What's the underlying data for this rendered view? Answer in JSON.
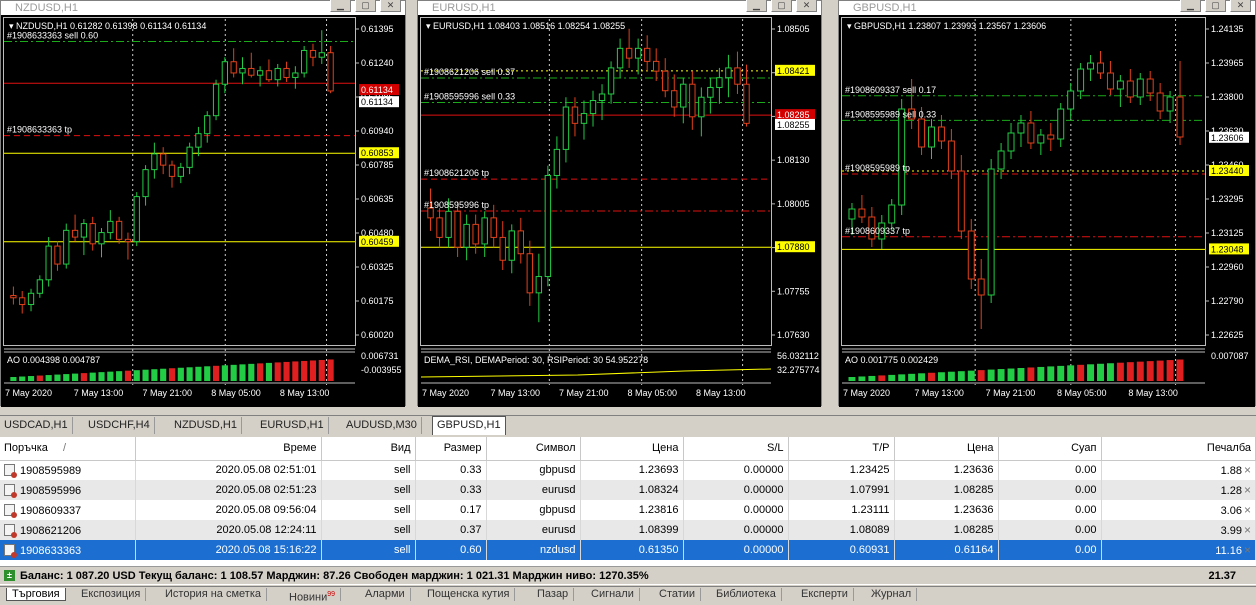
{
  "charts": [
    {
      "window_title": "NZDUSD,H1",
      "ohlc": "NZDUSD,H1  0.61282 0.61398 0.61134 0.61134",
      "price_labels": [
        "0.61395",
        "0.61240",
        "0.61085",
        "0.60940",
        "0.60785",
        "0.60635",
        "0.60480",
        "0.60325",
        "0.60175",
        "0.60020"
      ],
      "highlight_prices": [
        {
          "text": "0.61134",
          "y": 0.61134,
          "bg": "#d40000",
          "fg": "#ffffff"
        },
        {
          "text": "0.61134",
          "y": 0.6108,
          "bg": "#ffffff",
          "fg": "#000000"
        },
        {
          "text": "0.60853",
          "y": 0.60853,
          "bg": "#ffff00",
          "fg": "#000000"
        },
        {
          "text": "0.60459",
          "y": 0.60459,
          "bg": "#ffff00",
          "fg": "#000000"
        }
      ],
      "order_labels": [
        {
          "text": "#1908633363 sell 0.60",
          "y": 0.6135
        },
        {
          "text": "#1908633363 tp",
          "y": 0.60931
        }
      ],
      "hlines": [
        {
          "y": 0.6135,
          "color": "#1aaa1a",
          "style": "dashdot"
        },
        {
          "y": 0.61164,
          "color": "#e01010",
          "style": "solid"
        },
        {
          "y": 0.60931,
          "color": "#e01010",
          "style": "dash"
        },
        {
          "y": 0.60853,
          "color": "#ffff00",
          "style": "solid"
        },
        {
          "y": 0.60459,
          "color": "#ffff00",
          "style": "solid"
        }
      ],
      "indicator": {
        "text": "AO 0.004398 0.004787",
        "scale": [
          "0.006731",
          "-0.003955"
        ],
        "trend": "up"
      },
      "time_labels": [
        "7 May 2020",
        "7 May 13:00",
        "7 May 21:00",
        "8 May 05:00",
        "8 May 13:00"
      ],
      "range": [
        0.6,
        0.6145
      ],
      "candles": [
        [
          0.6022,
          0.6026,
          0.6018,
          0.6021
        ],
        [
          0.6021,
          0.6024,
          0.6014,
          0.6018
        ],
        [
          0.6018,
          0.6025,
          0.6015,
          0.6023
        ],
        [
          0.6023,
          0.6031,
          0.6021,
          0.6029
        ],
        [
          0.6029,
          0.6048,
          0.6026,
          0.6044
        ],
        [
          0.6044,
          0.6046,
          0.6033,
          0.6036
        ],
        [
          0.6036,
          0.6054,
          0.6034,
          0.6051
        ],
        [
          0.6051,
          0.6058,
          0.6046,
          0.6048
        ],
        [
          0.6048,
          0.6056,
          0.604,
          0.6054
        ],
        [
          0.6054,
          0.6057,
          0.6042,
          0.6045
        ],
        [
          0.6045,
          0.6052,
          0.6039,
          0.605
        ],
        [
          0.605,
          0.606,
          0.6047,
          0.6055
        ],
        [
          0.6055,
          0.6057,
          0.6045,
          0.6047
        ],
        [
          0.6047,
          0.605,
          0.6038,
          0.6046
        ],
        [
          0.6046,
          0.6068,
          0.6044,
          0.6066
        ],
        [
          0.6066,
          0.608,
          0.6062,
          0.6078
        ],
        [
          0.6078,
          0.609,
          0.6074,
          0.6085
        ],
        [
          0.6085,
          0.6088,
          0.6076,
          0.608
        ],
        [
          0.608,
          0.6082,
          0.607,
          0.6075
        ],
        [
          0.6075,
          0.6081,
          0.6072,
          0.6079
        ],
        [
          0.6079,
          0.609,
          0.6076,
          0.6088
        ],
        [
          0.6088,
          0.6097,
          0.6084,
          0.6094
        ],
        [
          0.6094,
          0.6104,
          0.609,
          0.6102
        ],
        [
          0.6102,
          0.6118,
          0.61,
          0.6116
        ],
        [
          0.6116,
          0.6128,
          0.6112,
          0.6126
        ],
        [
          0.6126,
          0.6132,
          0.6119,
          0.6121
        ],
        [
          0.6121,
          0.6128,
          0.6116,
          0.6123
        ],
        [
          0.6123,
          0.613,
          0.6119,
          0.612
        ],
        [
          0.612,
          0.6124,
          0.6115,
          0.6122
        ],
        [
          0.6122,
          0.6127,
          0.6117,
          0.6118
        ],
        [
          0.6118,
          0.6125,
          0.6115,
          0.6123
        ],
        [
          0.6123,
          0.6126,
          0.6117,
          0.6119
        ],
        [
          0.6119,
          0.6124,
          0.6114,
          0.6121
        ],
        [
          0.6121,
          0.6133,
          0.6119,
          0.6131
        ],
        [
          0.6131,
          0.6134,
          0.6124,
          0.6128
        ],
        [
          0.6128,
          0.614,
          0.6125,
          0.613
        ],
        [
          0.613,
          0.6133,
          0.6112,
          0.6113
        ]
      ]
    },
    {
      "window_title": "EURUSD,H1",
      "ohlc": "EURUSD,H1  1.08403 1.08516 1.08254 1.08255",
      "price_labels": [
        "1.08505",
        "1.08380",
        "1.08255",
        "1.08130",
        "1.08005",
        "1.07880",
        "1.07755",
        "1.07630"
      ],
      "highlight_prices": [
        {
          "text": "1.08421",
          "y": 1.08421,
          "bg": "#ffff00",
          "fg": "#000000"
        },
        {
          "text": "1.08285",
          "y": 1.08285,
          "bg": "#d40000",
          "fg": "#ffffff"
        },
        {
          "text": "1.08255",
          "y": 1.08255,
          "bg": "#ffffff",
          "fg": "#000000"
        },
        {
          "text": "1.07880",
          "y": 1.0788,
          "bg": "#ffff00",
          "fg": "#000000"
        }
      ],
      "order_labels": [
        {
          "text": "#1908621206 sell 0.37",
          "y": 1.08399
        },
        {
          "text": "#1908595996 sell 0.33",
          "y": 1.08324
        },
        {
          "text": "#1908621206 tp",
          "y": 1.08089
        },
        {
          "text": "#1908595996 tp",
          "y": 1.07991
        }
      ],
      "hlines": [
        {
          "y": 1.08421,
          "color": "#ffff00",
          "style": "dot"
        },
        {
          "y": 1.08399,
          "color": "#1aaa1a",
          "style": "dashdot"
        },
        {
          "y": 1.08324,
          "color": "#1aaa1a",
          "style": "dashdot"
        },
        {
          "y": 1.08285,
          "color": "#e01010",
          "style": "solid"
        },
        {
          "y": 1.08089,
          "color": "#e01010",
          "style": "dash"
        },
        {
          "y": 1.07991,
          "color": "#e01010",
          "style": "dashdot"
        },
        {
          "y": 1.0788,
          "color": "#ffff00",
          "style": "solid"
        }
      ],
      "indicator": {
        "text": "DEMA_RSI, DEMAPeriod: 30, RSIPeriod: 30  54.952278",
        "scale": [
          "56.032112",
          "32.275774"
        ],
        "trend": "flat"
      },
      "time_labels": [
        "7 May 2020",
        "7 May 13:00",
        "7 May 21:00",
        "8 May 05:00",
        "8 May 13:00"
      ],
      "range": [
        1.0758,
        1.0858
      ],
      "candles": [
        [
          1.08,
          1.0806,
          1.0793,
          1.0797
        ],
        [
          1.0797,
          1.08,
          1.0788,
          1.0791
        ],
        [
          1.0791,
          1.0803,
          1.0788,
          1.0799
        ],
        [
          1.0799,
          1.0802,
          1.0785,
          1.0788
        ],
        [
          1.0788,
          1.0798,
          1.0784,
          1.0795
        ],
        [
          1.0795,
          1.0798,
          1.0786,
          1.0789
        ],
        [
          1.0789,
          1.0799,
          1.0785,
          1.0797
        ],
        [
          1.0797,
          1.0801,
          1.0788,
          1.0791
        ],
        [
          1.0791,
          1.0796,
          1.0781,
          1.0784
        ],
        [
          1.0784,
          1.0795,
          1.078,
          1.0793
        ],
        [
          1.0793,
          1.0797,
          1.0783,
          1.0786
        ],
        [
          1.0786,
          1.079,
          1.077,
          1.0774
        ],
        [
          1.0774,
          1.0786,
          1.0765,
          1.0779
        ],
        [
          1.0779,
          1.0813,
          1.0776,
          1.081
        ],
        [
          1.081,
          1.0822,
          1.0806,
          1.0818
        ],
        [
          1.0818,
          1.0834,
          1.0814,
          1.0831
        ],
        [
          1.0831,
          1.0834,
          1.0822,
          1.0826
        ],
        [
          1.0826,
          1.0833,
          1.0821,
          1.0829
        ],
        [
          1.0829,
          1.0836,
          1.0825,
          1.0833
        ],
        [
          1.0833,
          1.0838,
          1.0827,
          1.0835
        ],
        [
          1.0835,
          1.0845,
          1.0832,
          1.0843
        ],
        [
          1.0843,
          1.0852,
          1.084,
          1.0849
        ],
        [
          1.0849,
          1.0855,
          1.0843,
          1.0846
        ],
        [
          1.0846,
          1.0852,
          1.0841,
          1.0849
        ],
        [
          1.0849,
          1.0853,
          1.0842,
          1.0845
        ],
        [
          1.0845,
          1.0849,
          1.0839,
          1.0842
        ],
        [
          1.0842,
          1.0846,
          1.0834,
          1.0836
        ],
        [
          1.0836,
          1.0841,
          1.0828,
          1.0831
        ],
        [
          1.0831,
          1.084,
          1.0826,
          1.0838
        ],
        [
          1.0838,
          1.0842,
          1.0824,
          1.0828
        ],
        [
          1.0828,
          1.0837,
          1.0822,
          1.0834
        ],
        [
          1.0834,
          1.084,
          1.0829,
          1.0837
        ],
        [
          1.0837,
          1.0843,
          1.0832,
          1.084
        ],
        [
          1.084,
          1.0847,
          1.0834,
          1.0843
        ],
        [
          1.0843,
          1.0848,
          1.0835,
          1.0838
        ],
        [
          1.0838,
          1.0844,
          1.0825,
          1.0826
        ]
      ]
    },
    {
      "window_title": "GBPUSD,H1",
      "ohlc": "GBPUSD,H1  1.23807 1.23993 1.23567 1.23606",
      "price_labels": [
        "1.24135",
        "1.23965",
        "1.23800",
        "1.23630",
        "1.23460",
        "1.23295",
        "1.23125",
        "1.22960",
        "1.22790",
        "1.22625"
      ],
      "highlight_prices": [
        {
          "text": "1.23606",
          "y": 1.23606,
          "bg": "#ffffff",
          "fg": "#000000"
        },
        {
          "text": "1.23440",
          "y": 1.2344,
          "bg": "#ffff00",
          "fg": "#000000"
        },
        {
          "text": "1.23048",
          "y": 1.23048,
          "bg": "#ffff00",
          "fg": "#000000"
        }
      ],
      "order_labels": [
        {
          "text": "#1908609337 sell 0.17",
          "y": 1.23816
        },
        {
          "text": "#1908595989 sell 0.33",
          "y": 1.23693
        },
        {
          "text": "#1908595989 tp",
          "y": 1.23425
        },
        {
          "text": "#1908609337 tp",
          "y": 1.23111
        }
      ],
      "hlines": [
        {
          "y": 1.23816,
          "color": "#1aaa1a",
          "style": "dashdot"
        },
        {
          "y": 1.23693,
          "color": "#1aaa1a",
          "style": "dashdot"
        },
        {
          "y": 1.2344,
          "color": "#ffff00",
          "style": "dot"
        },
        {
          "y": 1.23425,
          "color": "#e01010",
          "style": "dash"
        },
        {
          "y": 1.23111,
          "color": "#e01010",
          "style": "dashdot"
        },
        {
          "y": 1.23048,
          "color": "#ffff00",
          "style": "solid"
        }
      ],
      "indicator": {
        "text": "AO 0.001775 0.002429",
        "scale": [
          "0.007087"
        ],
        "trend": "up"
      },
      "time_labels": [
        "7 May 2020",
        "7 May 13:00",
        "7 May 21:00",
        "8 May 05:00",
        "8 May 13:00"
      ],
      "range": [
        1.2257,
        1.242
      ],
      "candles": [
        [
          1.232,
          1.2328,
          1.2312,
          1.2325
        ],
        [
          1.2325,
          1.2332,
          1.2318,
          1.2321
        ],
        [
          1.2321,
          1.2326,
          1.2306,
          1.231
        ],
        [
          1.231,
          1.2322,
          1.2305,
          1.2318
        ],
        [
          1.2318,
          1.233,
          1.2314,
          1.2327
        ],
        [
          1.2327,
          1.238,
          1.2322,
          1.2375
        ],
        [
          1.2375,
          1.239,
          1.2365,
          1.237
        ],
        [
          1.237,
          1.2376,
          1.2352,
          1.2356
        ],
        [
          1.2356,
          1.237,
          1.235,
          1.2366
        ],
        [
          1.2366,
          1.2372,
          1.2355,
          1.2359
        ],
        [
          1.2359,
          1.2365,
          1.234,
          1.2344
        ],
        [
          1.2344,
          1.2352,
          1.231,
          1.2314
        ],
        [
          1.2314,
          1.232,
          1.2285,
          1.229
        ],
        [
          1.229,
          1.23,
          1.2265,
          1.2282
        ],
        [
          1.2282,
          1.235,
          1.2278,
          1.2345
        ],
        [
          1.2345,
          1.2358,
          1.234,
          1.2354
        ],
        [
          1.2354,
          1.2368,
          1.235,
          1.2363
        ],
        [
          1.2363,
          1.2372,
          1.2356,
          1.2368
        ],
        [
          1.2368,
          1.2374,
          1.2355,
          1.2358
        ],
        [
          1.2358,
          1.2365,
          1.2352,
          1.2362
        ],
        [
          1.2362,
          1.2368,
          1.2354,
          1.236
        ],
        [
          1.236,
          1.2378,
          1.2356,
          1.2375
        ],
        [
          1.2375,
          1.2388,
          1.237,
          1.2384
        ],
        [
          1.2384,
          1.2398,
          1.238,
          1.2395
        ],
        [
          1.2395,
          1.2402,
          1.2389,
          1.2398
        ],
        [
          1.2398,
          1.2404,
          1.239,
          1.2393
        ],
        [
          1.2393,
          1.2399,
          1.2382,
          1.2385
        ],
        [
          1.2385,
          1.2392,
          1.2376,
          1.2389
        ],
        [
          1.2389,
          1.2395,
          1.2378,
          1.2381
        ],
        [
          1.2381,
          1.2393,
          1.2377,
          1.239
        ],
        [
          1.239,
          1.2394,
          1.2379,
          1.2383
        ],
        [
          1.2383,
          1.2388,
          1.237,
          1.2374
        ],
        [
          1.2374,
          1.2384,
          1.2368,
          1.2381
        ],
        [
          1.2381,
          1.2399,
          1.2357,
          1.2361
        ]
      ]
    }
  ],
  "symbol_tabs": [
    "USDCAD,H1",
    "USDCHF,H4",
    "NZDUSD,H1",
    "EURUSD,H1",
    "AUDUSD,M30",
    "GBPUSD,H1"
  ],
  "active_symbol_tab": 5,
  "table": {
    "headers": [
      "Поръчка",
      "Време",
      "Вид",
      "Размер",
      "Символ",
      "Цена",
      "S/L",
      "T/P",
      "Цена",
      "Суап",
      "Печалба"
    ],
    "rows": [
      [
        "1908595989",
        "2020.05.08 02:51:01",
        "sell",
        "0.33",
        "gbpusd",
        "1.23693",
        "0.00000",
        "1.23425",
        "1.23636",
        "0.00",
        "1.88"
      ],
      [
        "1908595996",
        "2020.05.08 02:51:23",
        "sell",
        "0.33",
        "eurusd",
        "1.08324",
        "0.00000",
        "1.07991",
        "1.08285",
        "0.00",
        "1.28"
      ],
      [
        "1908609337",
        "2020.05.08 09:56:04",
        "sell",
        "0.17",
        "gbpusd",
        "1.23816",
        "0.00000",
        "1.23111",
        "1.23636",
        "0.00",
        "3.06"
      ],
      [
        "1908621206",
        "2020.05.08 12:24:11",
        "sell",
        "0.37",
        "eurusd",
        "1.08399",
        "0.00000",
        "1.08089",
        "1.08285",
        "0.00",
        "3.99"
      ],
      [
        "1908633363",
        "2020.05.08 15:16:22",
        "sell",
        "0.60",
        "nzdusd",
        "0.61350",
        "0.00000",
        "0.60931",
        "0.61164",
        "0.00",
        "11.16"
      ]
    ],
    "selected_row": 4,
    "close_glyph": "×"
  },
  "balance_line": "Баланс: 1 087.20 USD  Текущ баланс: 1 108.57  Марджин: 87.26  Свободен марджин: 1 021.31  Марджин ниво: 1270.35%",
  "balance_total": "21.37",
  "bottom_tabs": [
    "Търговия",
    "Експозиция",
    "История на сметка",
    "Новини",
    "Аларми",
    "Пощенска кутия",
    "Пазар",
    "Сигнали",
    "Статии",
    "Библиотека",
    "Експерти",
    "Журнал"
  ],
  "bottom_tab_badge": "99",
  "active_bottom_tab": 0,
  "colors": {
    "bull": "#22cc44",
    "bear": "#e0401a",
    "selected_row": "#1c6fd0",
    "tp_line": "#e01010",
    "entry_line": "#1aaa1a",
    "level_line": "#ffff00"
  }
}
